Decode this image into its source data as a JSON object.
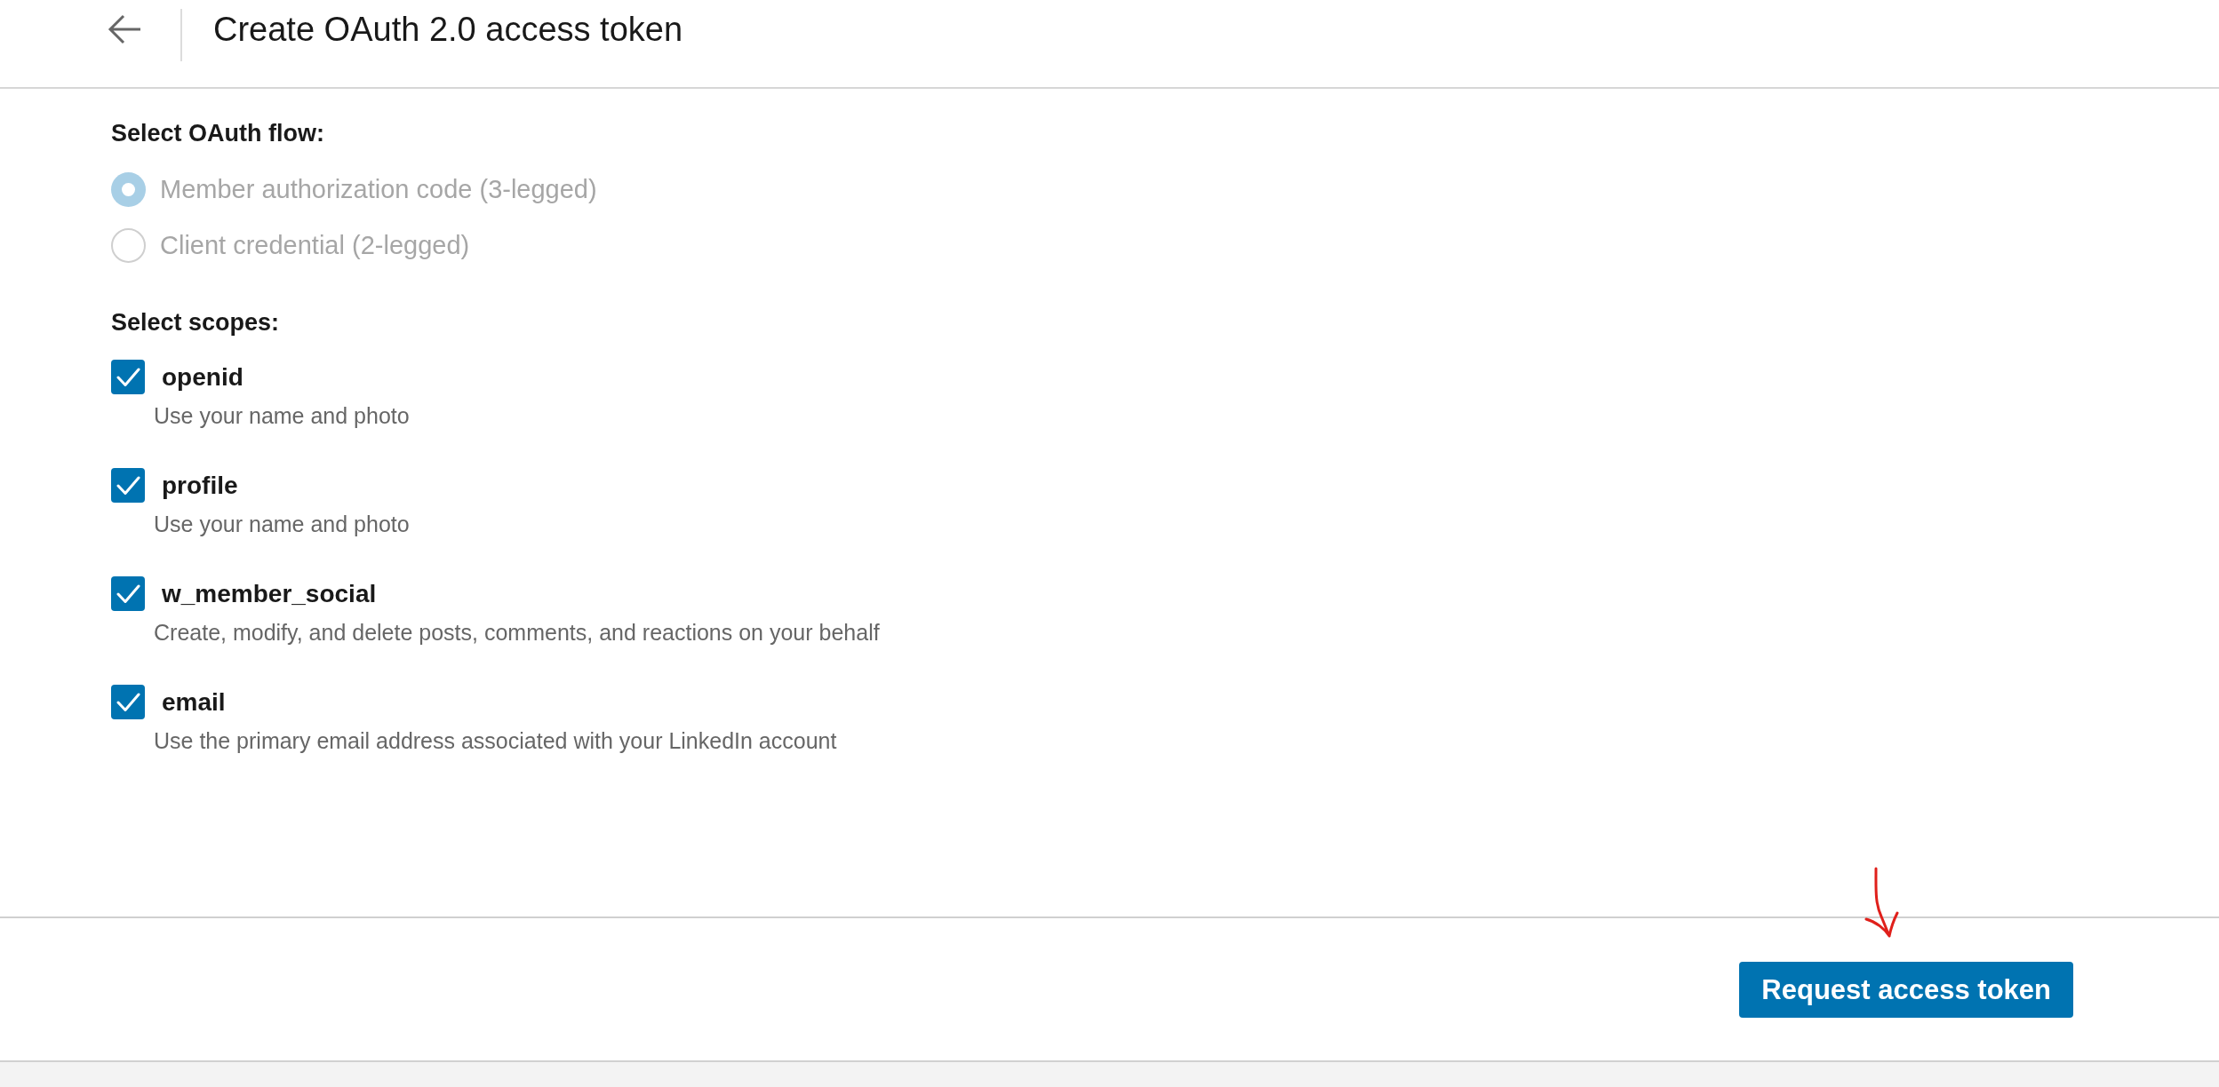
{
  "header": {
    "title": "Create OAuth 2.0 access token"
  },
  "oauth_flow": {
    "heading": "Select OAuth flow:",
    "options": [
      {
        "label": "Member authorization code (3-legged)",
        "selected": true,
        "disabled": true
      },
      {
        "label": "Client credential (2-legged)",
        "selected": false,
        "disabled": true
      }
    ]
  },
  "scopes": {
    "heading": "Select scopes:",
    "items": [
      {
        "name": "openid",
        "description": "Use your name and photo",
        "checked": true
      },
      {
        "name": "profile",
        "description": "Use your name and photo",
        "checked": true
      },
      {
        "name": "w_member_social",
        "description": "Create, modify, and delete posts, comments, and reactions on your behalf",
        "checked": true
      },
      {
        "name": "email",
        "description": "Use the primary email address associated with your LinkedIn account",
        "checked": true
      }
    ]
  },
  "footer": {
    "button": "Request access token"
  }
}
